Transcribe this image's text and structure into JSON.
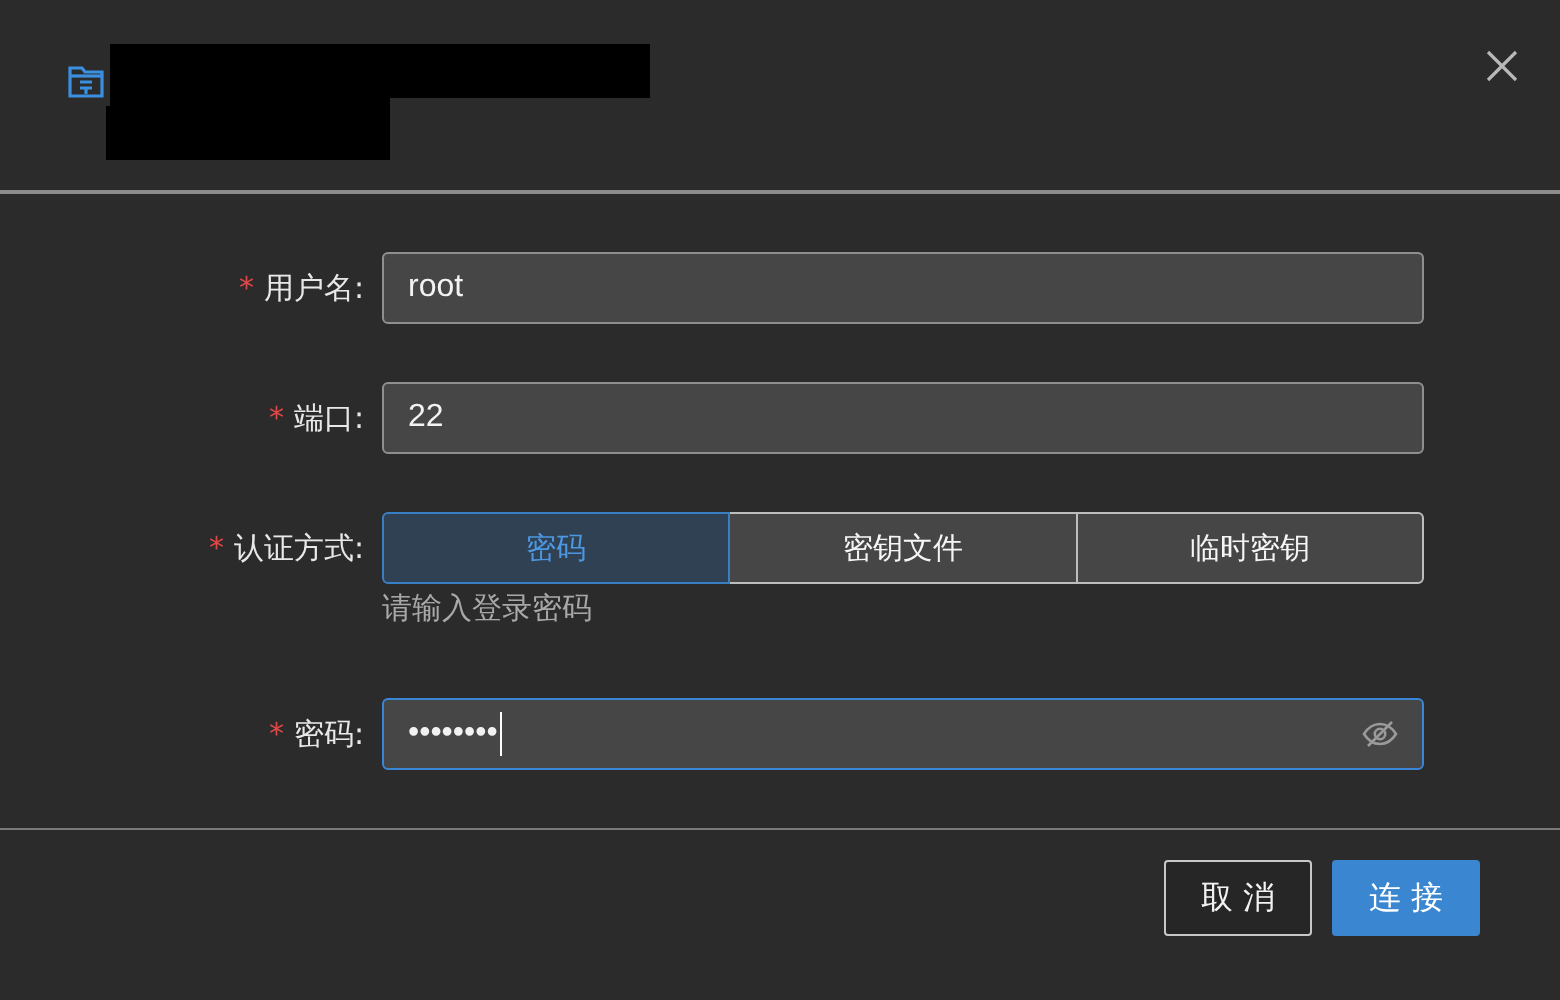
{
  "header": {
    "title_redacted": true
  },
  "fields": [
    {
      "kind": "text",
      "required_mark": "*",
      "label": "用户名:",
      "value": "root",
      "focused": false
    },
    {
      "kind": "text",
      "required_mark": "*",
      "label": "端口:",
      "value": "22",
      "focused": false
    },
    {
      "kind": "choice",
      "required_mark": "*",
      "label": "认证方式:",
      "options": [
        {
          "label": "密码",
          "selected": true
        },
        {
          "label": "密钥文件",
          "selected": false
        },
        {
          "label": "临时密钥",
          "selected": false
        }
      ],
      "hint": "请输入登录密码"
    },
    {
      "kind": "password",
      "required_mark": "*",
      "label": "密码:",
      "value": "••••••••",
      "focused": true
    }
  ],
  "buttons": [
    {
      "label": "取 消",
      "kind": "secondary"
    },
    {
      "label": "连 接",
      "kind": "primary"
    }
  ]
}
